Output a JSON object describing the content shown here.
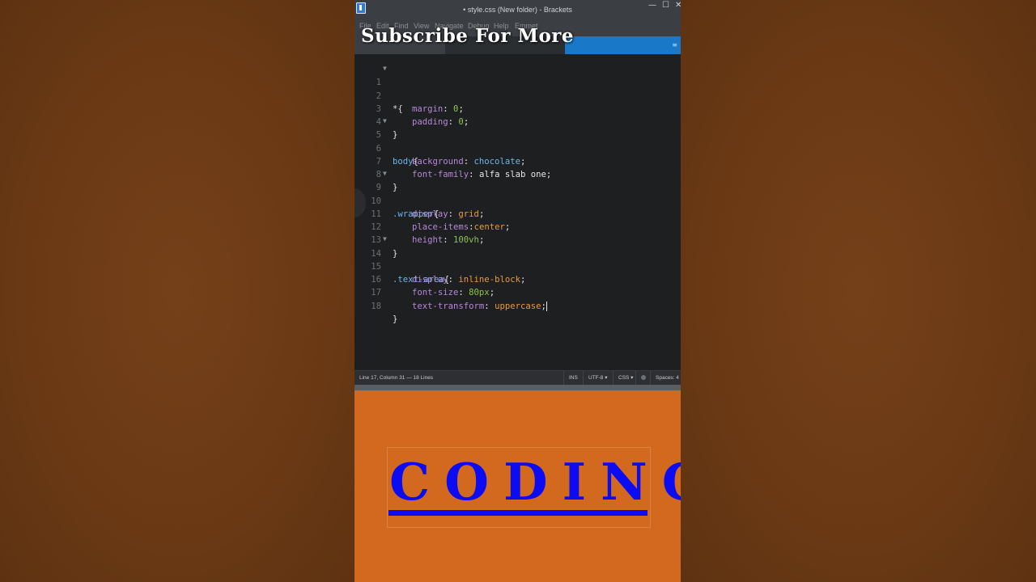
{
  "window": {
    "title": "• style.css (New folder) - Brackets",
    "controls": {
      "minimize": "—",
      "maximize": "☐",
      "close": "✕"
    }
  },
  "overlay": {
    "subscribe_text": "Subscribe For More"
  },
  "menu": {
    "items": [
      "File",
      "Edit",
      "Find",
      "View",
      "Navigate",
      "Debug",
      "Help",
      "Emmet"
    ]
  },
  "editor": {
    "lines": [
      {
        "n": "1",
        "fold": "▼"
      },
      {
        "n": "2"
      },
      {
        "n": "3"
      },
      {
        "n": "4"
      },
      {
        "n": "5",
        "fold": "▼"
      },
      {
        "n": "6"
      },
      {
        "n": "7"
      },
      {
        "n": "8"
      },
      {
        "n": "9",
        "fold": "▼"
      },
      {
        "n": "10"
      },
      {
        "n": "11"
      },
      {
        "n": "12"
      },
      {
        "n": "13"
      },
      {
        "n": "14",
        "fold": "▼"
      },
      {
        "n": "15"
      },
      {
        "n": "16"
      },
      {
        "n": "17"
      },
      {
        "n": "18"
      }
    ],
    "tokens": {
      "l1_sel": "*{",
      "l2_prop": "margin",
      "l2_val": "0",
      "l3_prop": "padding",
      "l3_val": "0",
      "l4": "}",
      "l5_sel": "body",
      "l5_brace": "{",
      "l6_prop": "background",
      "l6_val": "chocolate",
      "l7_prop": "font-family",
      "l7_val": "alfa slab one",
      "l8": "}",
      "l9_sel": ".wrapper",
      "l9_brace": "{",
      "l10_prop": "display",
      "l10_val": "grid",
      "l11_prop": "place-items",
      "l11_val": "center",
      "l12_prop": "height",
      "l12_val": "100vh",
      "l13": "}",
      "l14_sel": ".text-area",
      "l14_brace": "{",
      "l15_prop": "display",
      "l15_val": "inline-block",
      "l16_prop": "font-size",
      "l16_val": "80px",
      "l17_prop": "text-transform",
      "l17_val": "uppercase",
      "l18": "}"
    }
  },
  "status": {
    "position": "Line 17, Column 31 — 18 Lines",
    "ins": "INS",
    "encoding": "UTF-8 ▾",
    "language": "CSS ▾",
    "spaces": "Spaces: 4"
  },
  "preview": {
    "text": "CODING"
  },
  "colors": {
    "preview_bg": "#d2691e",
    "preview_text": "#0c0cf2",
    "accent_tab": "#1a78c9"
  }
}
